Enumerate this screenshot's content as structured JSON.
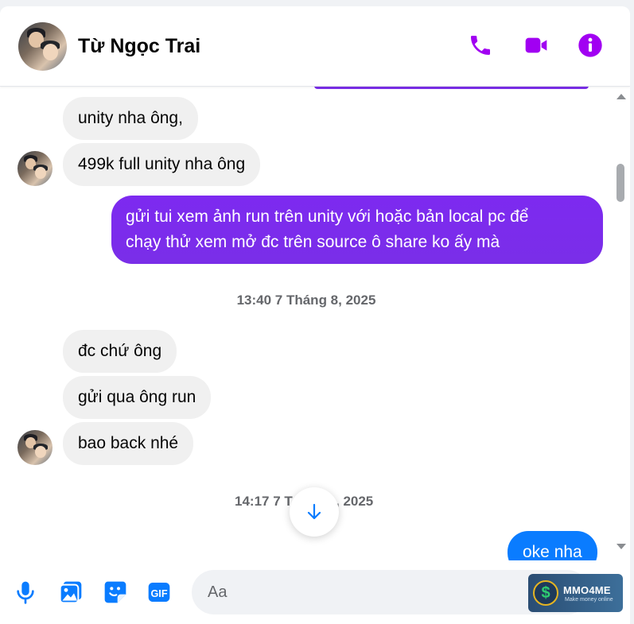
{
  "header": {
    "contact_name": "Từ Ngọc Trai",
    "icons": [
      "phone-icon",
      "video-icon",
      "info-icon"
    ],
    "accent_color": "#a100f2"
  },
  "messages": [
    {
      "text": "unity nha ông,",
      "side": "incoming"
    },
    {
      "text": "499k full unity nha ông",
      "side": "incoming"
    },
    {
      "line1": "gửi tui xem ảnh run trên unity với hoặc bản local pc để",
      "line2": "chạy thử xem mở đc trên source ô share ko ấy mà",
      "side": "outgoing"
    },
    {
      "timestamp": "13:40 7 Tháng 8, 2025"
    },
    {
      "text": "đc chứ ông",
      "side": "incoming"
    },
    {
      "text": "gửi qua ông run",
      "side": "incoming"
    },
    {
      "text": "bao back nhé",
      "side": "incoming"
    },
    {
      "timestamp_left": "14:17 7 T",
      "timestamp_right": ", 2025"
    },
    {
      "text": "oke nha",
      "side": "outgoing"
    }
  ],
  "composer": {
    "placeholder": "Aa",
    "icons": [
      "microphone-icon",
      "image-icon",
      "sticker-icon",
      "gif-icon"
    ],
    "gif_label": "GIF",
    "accent_color": "#0a7cff"
  },
  "watermark": {
    "title": "MMO4ME",
    "subtitle": "Make money online",
    "symbol": "$"
  }
}
